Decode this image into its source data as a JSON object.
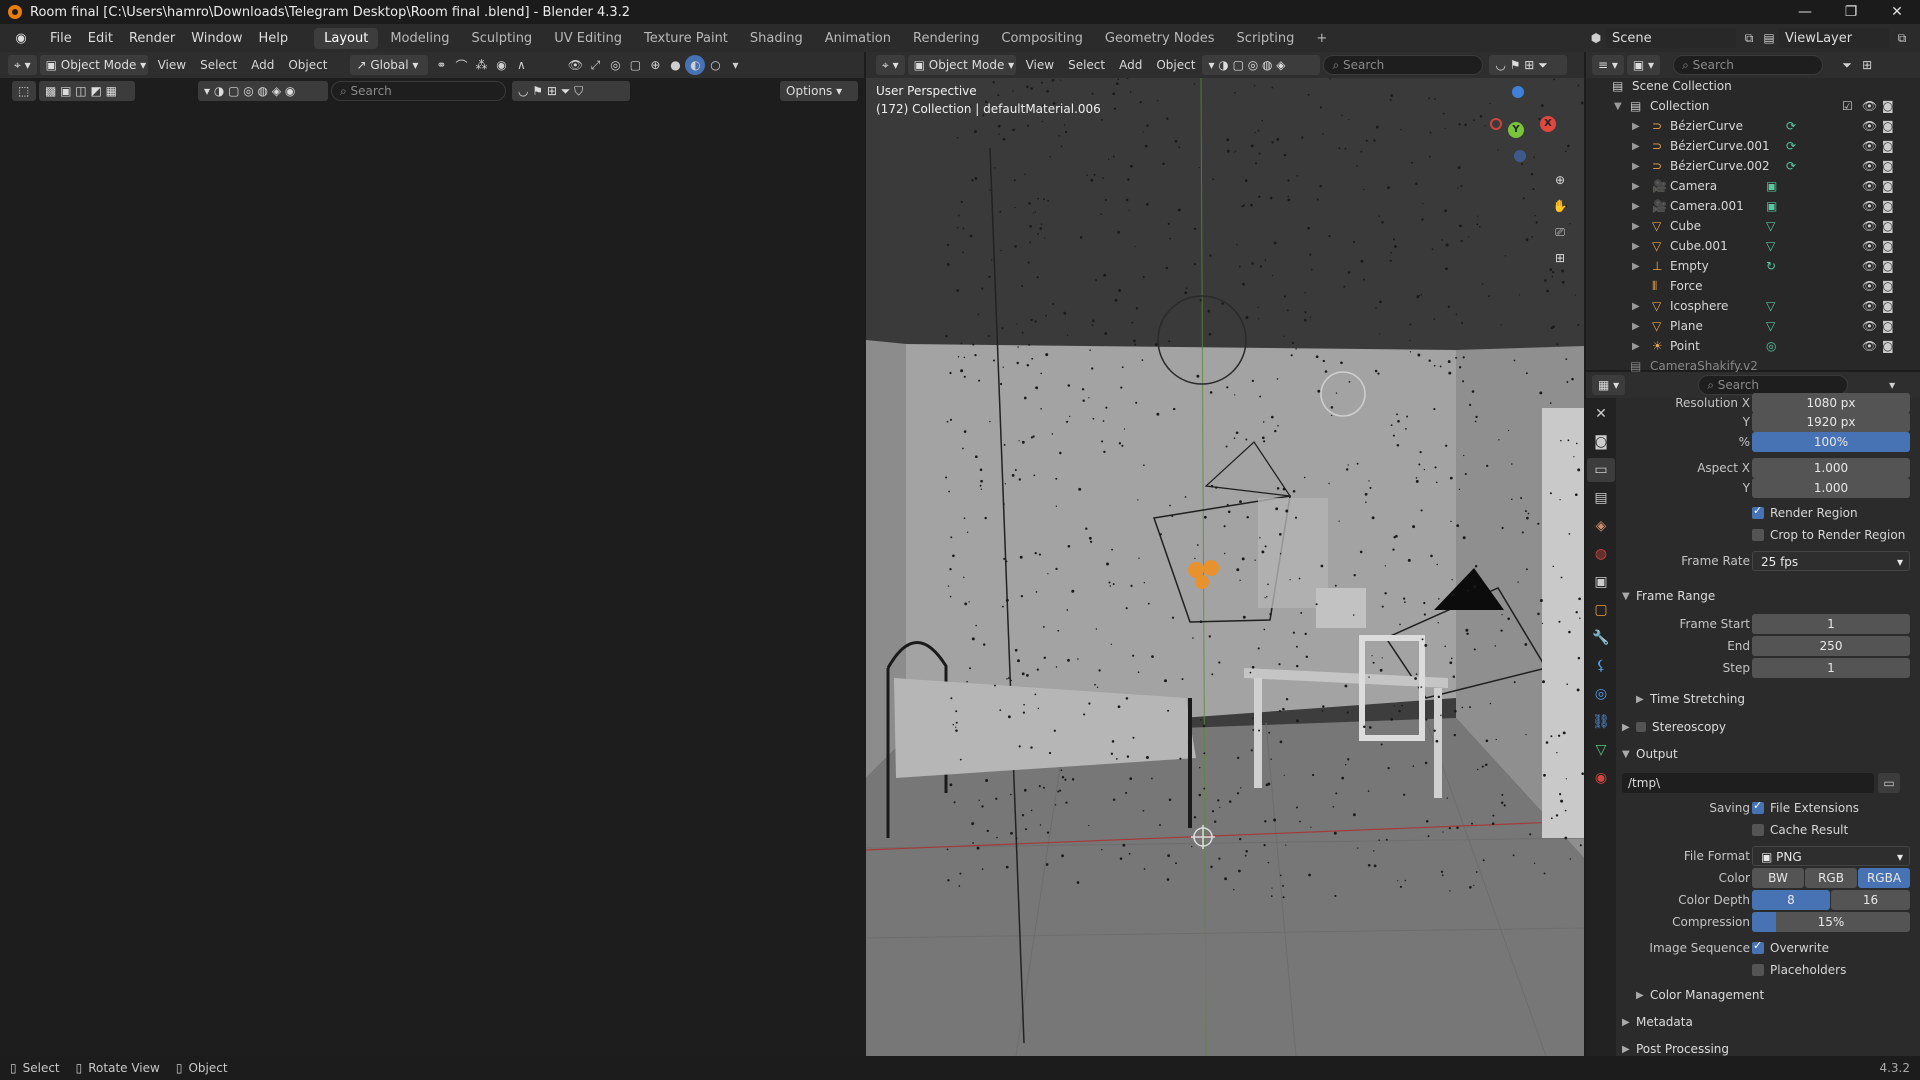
{
  "window": {
    "title": "Room final  [C:\\Users\\hamro\\Downloads\\Telegram Desktop\\Room final .blend] - Blender 4.3.2"
  },
  "menu": [
    "File",
    "Edit",
    "Render",
    "Window",
    "Help"
  ],
  "workspaces": [
    {
      "label": "Layout",
      "active": true
    },
    {
      "label": "Modeling"
    },
    {
      "label": "Sculpting"
    },
    {
      "label": "UV Editing"
    },
    {
      "label": "Texture Paint"
    },
    {
      "label": "Shading"
    },
    {
      "label": "Animation"
    },
    {
      "label": "Rendering"
    },
    {
      "label": "Compositing"
    },
    {
      "label": "Geometry Nodes"
    },
    {
      "label": "Scripting"
    }
  ],
  "scene": {
    "label": "Scene",
    "view_layer": "ViewLayer"
  },
  "viewport_left": {
    "mode": "Object Mode",
    "menus": [
      "View",
      "Select",
      "Add",
      "Object"
    ],
    "transform": "Global",
    "search_placeholder": "Search",
    "options": "Options"
  },
  "viewport_right": {
    "mode": "Object Mode",
    "menus": [
      "View",
      "Select",
      "Add",
      "Object"
    ],
    "search_placeholder": "Search",
    "overlay_title": "User Perspective",
    "overlay_sub": "(172) Collection | defaultMaterial.006",
    "gizmo": {
      "x": "X",
      "y": "Y"
    }
  },
  "outliner": {
    "search_placeholder": "Search",
    "root": "Scene Collection",
    "collection": "Collection",
    "items": [
      {
        "name": "BézierCurve",
        "icon": "curve"
      },
      {
        "name": "BézierCurve.001",
        "icon": "curve"
      },
      {
        "name": "BézierCurve.002",
        "icon": "curve"
      },
      {
        "name": "Camera",
        "icon": "camera"
      },
      {
        "name": "Camera.001",
        "icon": "camera"
      },
      {
        "name": "Cube",
        "icon": "mesh"
      },
      {
        "name": "Cube.001",
        "icon": "mesh"
      },
      {
        "name": "Empty",
        "icon": "empty"
      },
      {
        "name": "Force",
        "icon": "force"
      },
      {
        "name": "Icosphere",
        "icon": "mesh"
      },
      {
        "name": "Plane",
        "icon": "mesh"
      },
      {
        "name": "Point",
        "icon": "light"
      }
    ],
    "partial": "CameraShakify.v2"
  },
  "properties": {
    "search_placeholder": "Search",
    "res_x_label": "Resolution X",
    "res_x": "1080 px",
    "res_y_label": "Y",
    "res_y": "1920 px",
    "pct_label": "%",
    "pct": "100%",
    "aspect_x_label": "Aspect X",
    "aspect_x": "1.000",
    "aspect_y_label": "Y",
    "aspect_y": "1.000",
    "render_region": "Render Region",
    "crop": "Crop to Render Region",
    "frame_rate_label": "Frame Rate",
    "frame_rate": "25 fps",
    "frame_range": "Frame Range",
    "frame_start_label": "Frame Start",
    "frame_start": "1",
    "end_label": "End",
    "end": "250",
    "step_label": "Step",
    "step": "1",
    "time_stretching": "Time Stretching",
    "stereoscopy": "Stereoscopy",
    "output": "Output",
    "path": "/tmp\\",
    "saving_label": "Saving",
    "file_ext": "File Extensions",
    "cache": "Cache Result",
    "file_format_label": "File Format",
    "file_format": "PNG",
    "color_label": "Color",
    "color_opts": [
      "BW",
      "RGB",
      "RGBA"
    ],
    "depth_label": "Color Depth",
    "depth_opts": [
      "8",
      "16"
    ],
    "compression_label": "Compression",
    "compression": "15%",
    "compression_value": 15,
    "image_seq_label": "Image Sequence",
    "overwrite": "Overwrite",
    "placeholders": "Placeholders",
    "color_management": "Color Management",
    "metadata": "Metadata",
    "post_processing": "Post Processing"
  },
  "status": {
    "select": "Select",
    "rotate": "Rotate View",
    "object": "Object",
    "version": "4.3.2"
  }
}
